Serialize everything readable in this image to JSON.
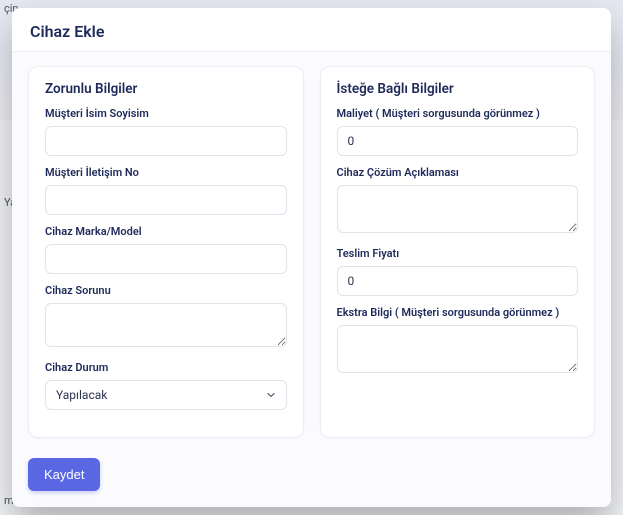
{
  "background": {
    "top_left_snippet": "çin",
    "yap_snippet": "Yap",
    "bottom_snippet": "m f"
  },
  "modal": {
    "title": "Cihaz Ekle",
    "left": {
      "title": "Zorunlu Bilgiler",
      "name_label": "Müşteri İsim Soyisim",
      "name_value": "",
      "contact_label": "Müşteri İletişim No",
      "contact_value": "",
      "model_label": "Cihaz Marka/Model",
      "model_value": "",
      "problem_label": "Cihaz Sorunu",
      "problem_value": "",
      "status_label": "Cihaz Durum",
      "status_value": "Yapılacak"
    },
    "right": {
      "title": "İsteğe Bağlı Bilgiler",
      "cost_label": "Maliyet ( Müşteri sorgusunda görünmez )",
      "cost_value": "0",
      "solution_label": "Cihaz Çözüm Açıklaması",
      "solution_value": "",
      "delivery_price_label": "Teslim Fiyatı",
      "delivery_price_value": "0",
      "extra_label": "Ekstra Bilgi ( Müşteri sorgusunda görünmez )",
      "extra_value": ""
    },
    "save_label": "Kaydet"
  }
}
